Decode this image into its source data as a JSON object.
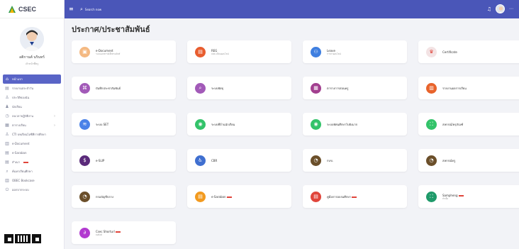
{
  "brand": {
    "name": "CSEC"
  },
  "user": {
    "name": "อติกานต์ นรินทร์",
    "role": "เจ้าหน้าที่ครู"
  },
  "search": {
    "placeholder": "Search now"
  },
  "sidebar": {
    "items": [
      {
        "label": "หน้าแรก",
        "icon": "home-icon",
        "active": true
      },
      {
        "label": "รายงานประจำวัน",
        "icon": "report-icon"
      },
      {
        "label": "ประวัติของฉัน",
        "icon": "user-icon"
      },
      {
        "label": "นักเรียน",
        "icon": "student-icon"
      },
      {
        "label": "ลงเวลาปฏิบัติงาน",
        "icon": "clock-icon",
        "chevron": true
      },
      {
        "label": "ตารางเรียน",
        "icon": "calendar-icon",
        "chevron": true
      },
      {
        "label": "CTI บทเรียนไอซีทีการศึกษา",
        "icon": "person-icon"
      },
      {
        "label": "e-Document",
        "icon": "document-icon"
      },
      {
        "label": "e-Saraban",
        "icon": "book-icon"
      },
      {
        "label": "สำเนา",
        "icon": "copy-icon",
        "new": true
      },
      {
        "label": "ค้นหาเรียนศึกษา",
        "icon": "search-icon"
      },
      {
        "label": "OBEC Bookcase",
        "icon": "bookcase-icon"
      },
      {
        "label": "ออกจากระบบ",
        "icon": "logout-icon"
      }
    ]
  },
  "main": {
    "title": "ประกาศ/ประชาสัมพันธ์",
    "cards": [
      {
        "label": "e-Document",
        "sub": "ระบบเอกสารอิเล็กทรอนิกส์",
        "color": "#f4b982",
        "glyph": "▣"
      },
      {
        "label": "REG",
        "sub": "ลงทะเบียนออนไลน์",
        "color": "#e85d2f",
        "glyph": "▤"
      },
      {
        "label": "Leave",
        "sub": "การลาออนไลน์",
        "color": "#3f7fe0",
        "glyph": "⚇"
      },
      {
        "label": "Certificate",
        "sub": "",
        "color": "#f3e3e4",
        "glyph": "♛",
        "glyphColor": "#e0453b"
      },
      {
        "label": "บันทึกประชาสัมพันธ์",
        "sub": "",
        "color": "#a25ab8",
        "glyph": "⌘"
      },
      {
        "label": "ระบบพัสดุ",
        "sub": "",
        "color": "#a25ab8",
        "glyph": "⌕"
      },
      {
        "label": "ตารางการสอนครู",
        "sub": "",
        "color": "#a23f8f",
        "glyph": "▦"
      },
      {
        "label": "รายงานผลการเรียน",
        "sub": "",
        "color": "#e8632b",
        "glyph": "▥"
      },
      {
        "label": "ระบบ SET",
        "sub": "",
        "color": "#4a82e8",
        "glyph": "≋"
      },
      {
        "label": "ระบบที่บ้านนักเรียน",
        "sub": "",
        "color": "#33c36a",
        "glyph": "◉"
      },
      {
        "label": "ระบบทัศนศึกษาไปยังมาก",
        "sub": "",
        "color": "#33c36a",
        "glyph": "◉"
      },
      {
        "label": "สหกรณ์/ครุภัณฑ์",
        "sub": "",
        "color": "#33c36a",
        "glyph": "⛶"
      },
      {
        "label": "e-SLIP",
        "sub": "",
        "color": "#5a2a7a",
        "glyph": "$"
      },
      {
        "label": "CBR",
        "sub": "",
        "color": "#3f6fd0",
        "glyph": "♿"
      },
      {
        "label": "กบข.",
        "sub": "",
        "color": "#6b4f2a",
        "glyph": "◔"
      },
      {
        "label": "สหกรณ์ครู",
        "sub": "",
        "color": "#6b4f2a",
        "glyph": "◔"
      },
      {
        "label": "กรมบัญชีกลาง",
        "sub": "",
        "color": "#6b4f2a",
        "glyph": "◔"
      },
      {
        "label": "e-Saraban",
        "sub": "",
        "color": "#f29a1f",
        "glyph": "▤",
        "new": true
      },
      {
        "label": "คู่มือการอบรมศึกษา",
        "sub": "",
        "color": "#e0453b",
        "glyph": "▤",
        "new": true
      },
      {
        "label": "Sampheng",
        "sub": "สำเพ็ง",
        "color": "#1f9a6a",
        "glyph": "⛶",
        "new": true
      },
      {
        "label": "Csec Shorturl",
        "sub": "ย่อลิงค์",
        "color": "#b23ad0",
        "glyph": "∂",
        "new": true
      }
    ]
  }
}
